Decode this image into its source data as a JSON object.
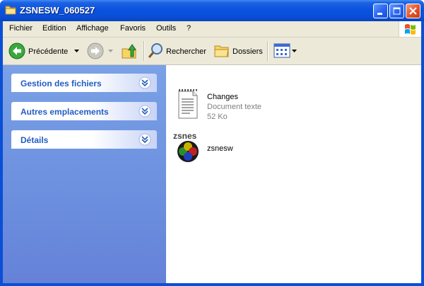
{
  "window": {
    "title": "ZSNESW_060527"
  },
  "menu": [
    "Fichier",
    "Edition",
    "Affichage",
    "Favoris",
    "Outils",
    "?"
  ],
  "toolbar": {
    "back_label": "Précédente",
    "search_label": "Rechercher",
    "folders_label": "Dossiers"
  },
  "tasks": [
    {
      "title": "Gestion des fichiers"
    },
    {
      "title": "Autres emplacements"
    },
    {
      "title": "Détails"
    }
  ],
  "files": [
    {
      "name": "Changes",
      "type": "Document texte",
      "size": "52 Ko",
      "icon": "text-document-icon"
    },
    {
      "name": "zsnesw",
      "icon": "zsnes-app-icon",
      "icon_text": "zsnes"
    }
  ],
  "colors": {
    "accent": "#215dc6",
    "titlebar": "#0a53df",
    "taskpane": "#6e92e0"
  }
}
